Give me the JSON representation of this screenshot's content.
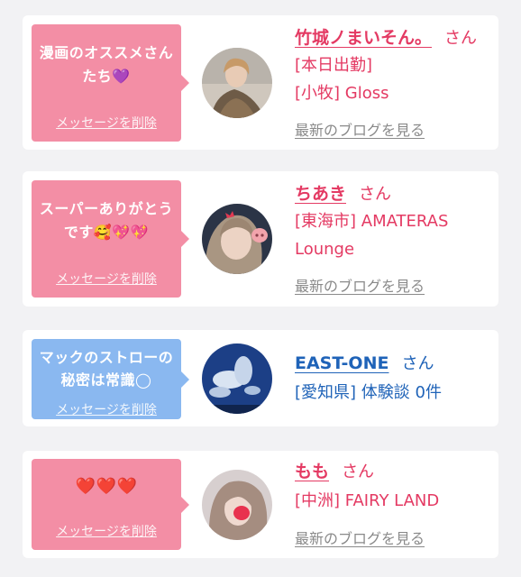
{
  "cards": [
    {
      "message": "漫画のオススメさんたち💜",
      "delete_label": "メッセージを削除",
      "name": "竹城ノまいそん。",
      "san": "さん",
      "line1": "[本日出勤]",
      "line2": "[小牧] Gloss",
      "blog_label": "最新のブログを見る"
    },
    {
      "message": "スーパーありがとうです🥰💖💖",
      "delete_label": "メッセージを削除",
      "name": "ちあき",
      "san": "さん",
      "line1": "[東海市] AMATERAS",
      "line2": "Lounge",
      "blog_label": "最新のブログを見る"
    },
    {
      "message": "マックのストローの秘密は常識◯",
      "delete_label": "メッセージを削除",
      "name": "EAST-ONE",
      "san": "さん",
      "line1": "[愛知県] 体験談 0件"
    },
    {
      "message": "❤️❤️❤️",
      "delete_label": "メッセージを削除",
      "name": "もも",
      "san": "さん",
      "line1": "[中洲] FAIRY LAND",
      "blog_label": "最新のブログを見る"
    }
  ],
  "colors": {
    "pink_bubble": "#f38ea5",
    "blue_bubble": "#8ab8f0",
    "pink_text": "#e43a63",
    "blue_text": "#1f63b8",
    "gray_link": "#8a8a8a",
    "background": "#f2f2f4"
  }
}
